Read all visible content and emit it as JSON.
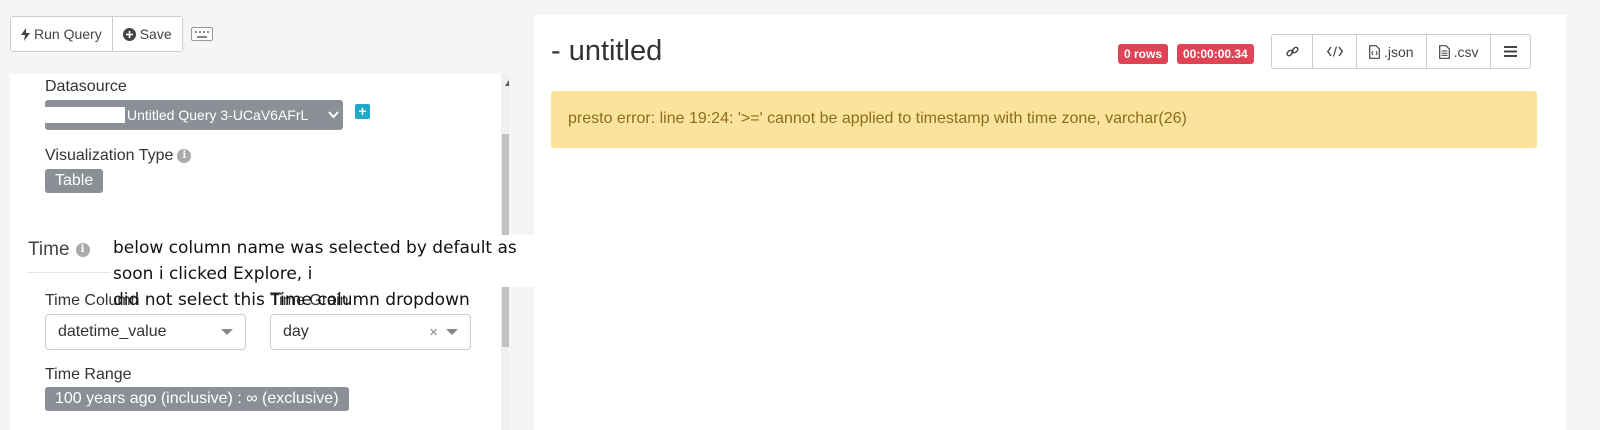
{
  "toolbar": {
    "run_query_icon": "bolt-icon",
    "run_query_label": "Run Query",
    "save_icon": "plus-circle-icon",
    "save_label": "Save",
    "keyboard_icon": "keyboard-icon"
  },
  "controls": {
    "datasource_label": "Datasource",
    "datasource_value": "Untitled Query 3-UCaV6AFrL",
    "visualization_label": "Visualization Type",
    "visualization_value": "Table",
    "time_section_title": "Time",
    "time_column_label": "Time Column",
    "time_column_value": "datetime_value",
    "time_grain_label": "Time Grain",
    "time_grain_value": "day",
    "time_range_label": "Time Range",
    "time_range_value": "100 years ago (inclusive) : ∞ (exclusive)"
  },
  "annotation": {
    "line1": "below column name was selected by default as soon i clicked Explore, i",
    "line2": "did not select this Time column dropdown"
  },
  "result": {
    "title": "- untitled",
    "rows_badge": "0 rows",
    "time_badge": "00:00:00.34",
    "actions": [
      {
        "icon": "link-icon",
        "label": ""
      },
      {
        "icon": "code-icon",
        "label": ""
      },
      {
        "icon": "json-file-icon",
        "label": ".json"
      },
      {
        "icon": "csv-file-icon",
        "label": ".csv"
      },
      {
        "icon": "menu-icon",
        "label": ""
      }
    ],
    "error_message": "presto error: line 19:24: '>=' cannot be applied to timestamp with time zone, varchar(26)"
  },
  "colors": {
    "badge_red": "#e04355",
    "warning_bg": "#fde29b",
    "tag_gray": "#8a9095",
    "accent_teal": "#20a7c9"
  }
}
